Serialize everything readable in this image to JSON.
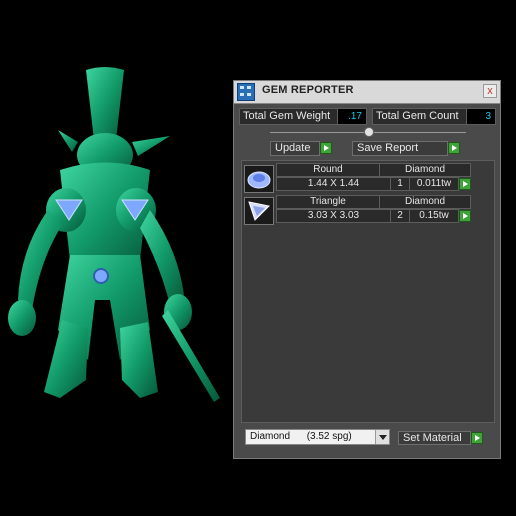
{
  "window": {
    "title": "GEM REPORTER",
    "close_label": "x"
  },
  "stats": {
    "weight_label": "Total Gem Weight",
    "weight_value": ".17",
    "count_label": "Total Gem Count",
    "count_value": "3"
  },
  "buttons": {
    "update": "Update",
    "save_report": "Save Report",
    "set_material": "Set Material"
  },
  "gems": [
    {
      "shape": "Round",
      "size": "1.44 X 1.44",
      "material": "Diamond",
      "count": "1",
      "weight": "0.011tw",
      "icon": "round-gem-icon"
    },
    {
      "shape": "Triangle",
      "size": "3.03 X 3.03",
      "material": "Diamond",
      "count": "2",
      "weight": "0.15tw",
      "icon": "triangle-gem-icon"
    }
  ],
  "material_select": {
    "value": "Diamond      (3.52 spg)"
  },
  "colors": {
    "model": "#1a9a6c",
    "accent_green": "#3fa33a",
    "value_cyan": "#19c9e8",
    "gem_blue": "#7ea8ff"
  }
}
